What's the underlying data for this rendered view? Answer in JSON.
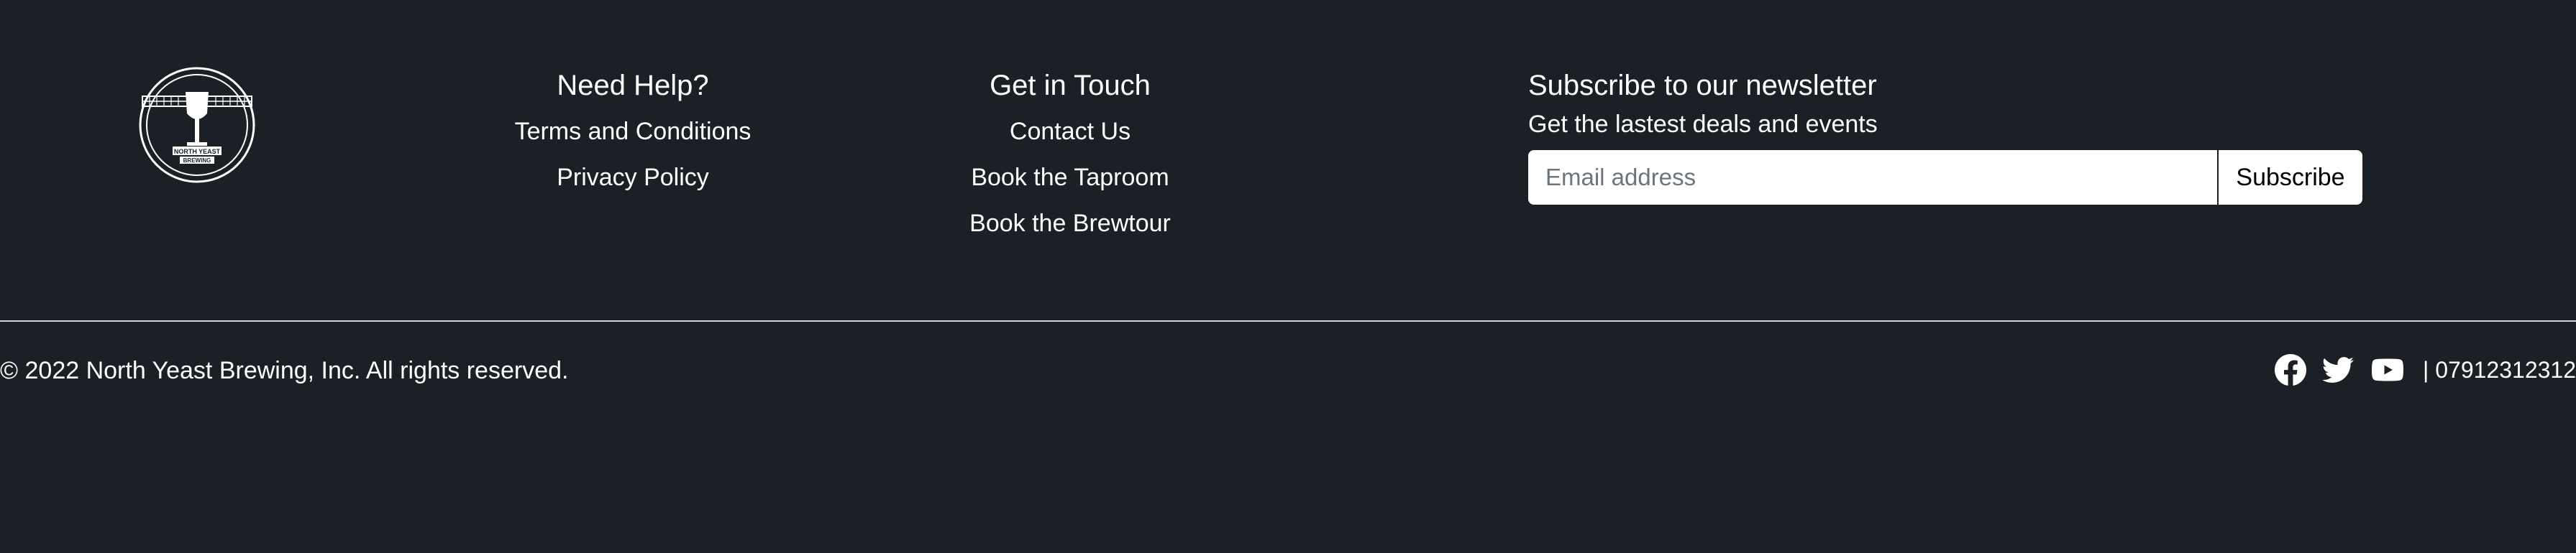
{
  "brand": {
    "logo_icon": "north-yeast-brewing-logo",
    "logo_text_line1": "NORTH YEAST",
    "logo_text_line2": "BREWING"
  },
  "help": {
    "title": "Need Help?",
    "links": [
      "Terms and Conditions",
      "Privacy Policy"
    ]
  },
  "contact": {
    "title": "Get in Touch",
    "links": [
      "Contact Us",
      "Book the Taproom",
      "Book the Brewtour"
    ]
  },
  "newsletter": {
    "title": "Subscribe to our newsletter",
    "subtitle": "Get the lastest deals and events",
    "email_placeholder": "Email address",
    "email_value": "",
    "button_label": "Subscribe"
  },
  "bottom": {
    "copyright": "© 2022 North Yeast Brewing, Inc. All rights reserved.",
    "social_icons": [
      "facebook-icon",
      "twitter-icon",
      "youtube-icon"
    ],
    "phone": "| 07912312312"
  },
  "colors": {
    "background": "#1b2026",
    "text": "#ffffff",
    "divider": "#ced4da",
    "input_bg": "#ffffff",
    "placeholder": "#6c757d"
  }
}
